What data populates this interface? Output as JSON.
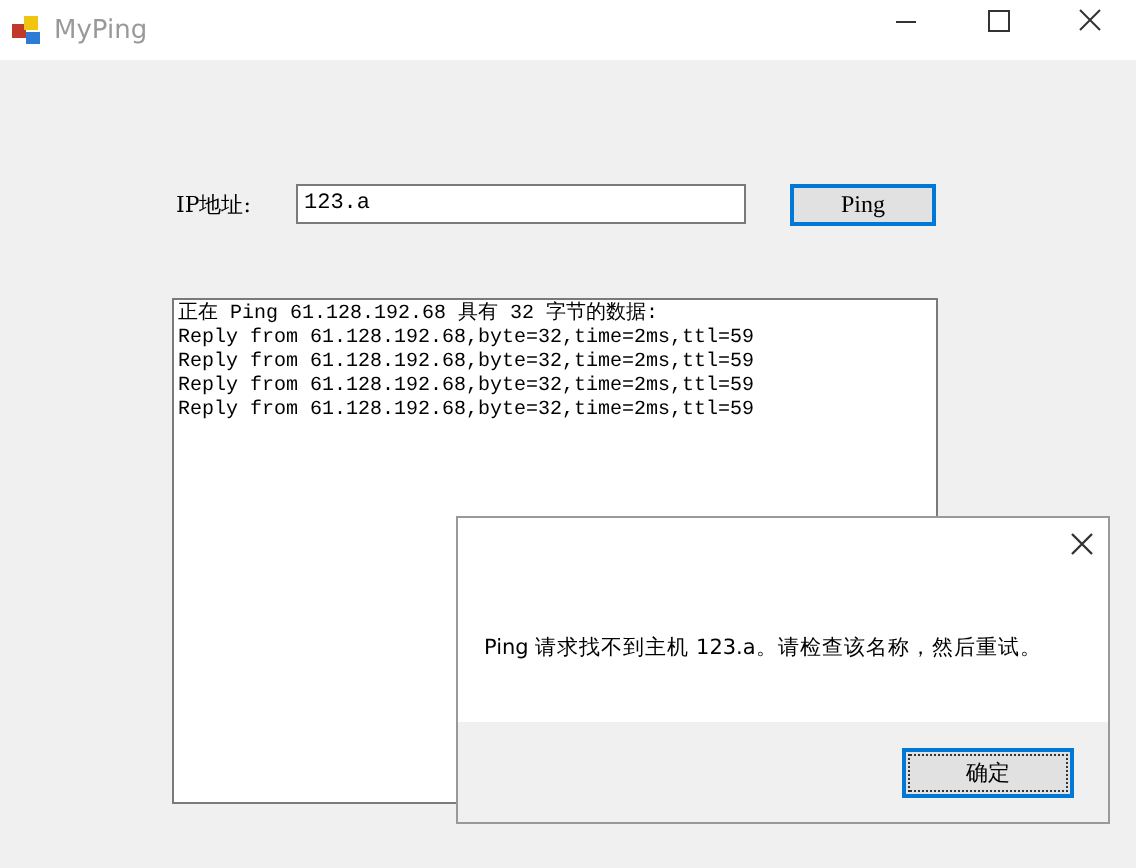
{
  "window": {
    "title": "MyPing"
  },
  "ip_label": "IP地址:",
  "ip_field": {
    "value": "123.a"
  },
  "ping_button": {
    "label": "Ping"
  },
  "output_lines": [
    "正在 Ping 61.128.192.68 具有 32 字节的数据:",
    "Reply from 61.128.192.68,byte=32,time=2ms,ttl=59",
    "Reply from 61.128.192.68,byte=32,time=2ms,ttl=59",
    "Reply from 61.128.192.68,byte=32,time=2ms,ttl=59",
    "Reply from 61.128.192.68,byte=32,time=2ms,ttl=59"
  ],
  "dialog": {
    "message": "Ping 请求找不到主机 123.a。请检查该名称，然后重试。",
    "ok_button": "确定"
  }
}
